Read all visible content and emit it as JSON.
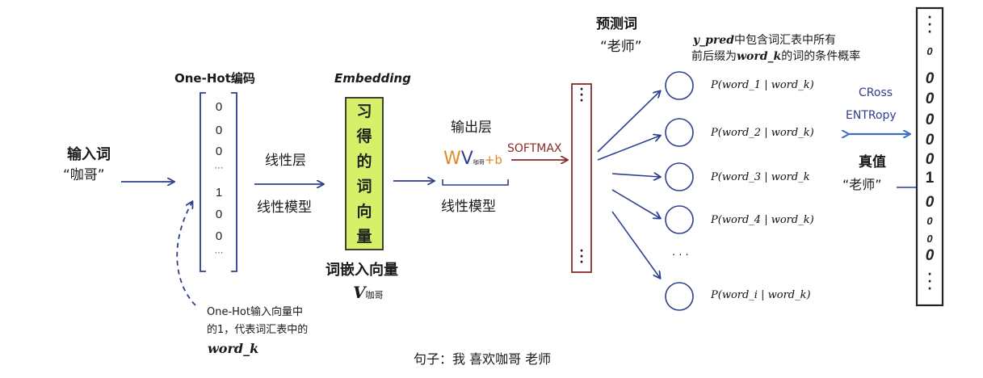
{
  "input_word": {
    "label": "输入词",
    "word": "“咖哥”"
  },
  "one_hot": {
    "title": "One-Hot编码",
    "values": [
      "0",
      "0",
      "0",
      "···",
      "1",
      "0",
      "0",
      "···"
    ]
  },
  "linear_layer": {
    "top": "线性层",
    "bottom": "线性模型"
  },
  "embedding": {
    "title": "Embedding",
    "chars": [
      "习",
      "得",
      "的",
      "词",
      "向",
      "量"
    ],
    "caption": "词嵌入向量",
    "vector_symbol": "V",
    "vector_sub": "咖哥"
  },
  "output_layer": {
    "title": "输出层",
    "formula_w": "W",
    "formula_v": "V",
    "formula_sub": "咖哥",
    "formula_b": "+b",
    "softmax": "SOFTMAX",
    "bottom": "线性模型"
  },
  "softmax_vector": {
    "dots_top": "·\n·\n·",
    "dots_bottom": "·\n·\n·"
  },
  "predicted": {
    "label": "预测词",
    "word": "“老师”"
  },
  "y_pred_note": {
    "line1_bold": "y_pred",
    "line1_rest": "中包含词汇表中所有",
    "line2_pre": "前后缀为",
    "line2_bold": "word_k",
    "line2_rest": "的词的条件概率"
  },
  "probabilities": [
    "P(word_1 | word_k)",
    "P(word_2 | word_k)",
    "P(word_3 | word_k",
    "P(word_4 | word_k)",
    "P(word_i | word_k)"
  ],
  "prob_ellipsis": "· · ·",
  "cross_entropy": {
    "line1": "CRoss",
    "line2": "ENTRopy"
  },
  "true_value": {
    "label": "真值",
    "word": "“老师”"
  },
  "true_vector": {
    "values": [
      "0",
      "0",
      "0",
      "0",
      "0",
      "0",
      "1",
      "0",
      "0",
      "0",
      "0"
    ],
    "top_dots": "·\n·\n·",
    "bottom_dots": "·\n·\n·"
  },
  "annotation": {
    "line1": "One-Hot输入向量中",
    "line2": "的1，代表词汇表中的",
    "line3": "word_k"
  },
  "sentence": "句子：我 喜欢咖哥 老师",
  "colors": {
    "blue_arrow": "#2e3f8f",
    "red_arrow": "#8b2a2a",
    "embedding_fill": "#d6f06a",
    "orange": "#e08a2a",
    "cross_entropy_blue": "#3a6fc4"
  }
}
